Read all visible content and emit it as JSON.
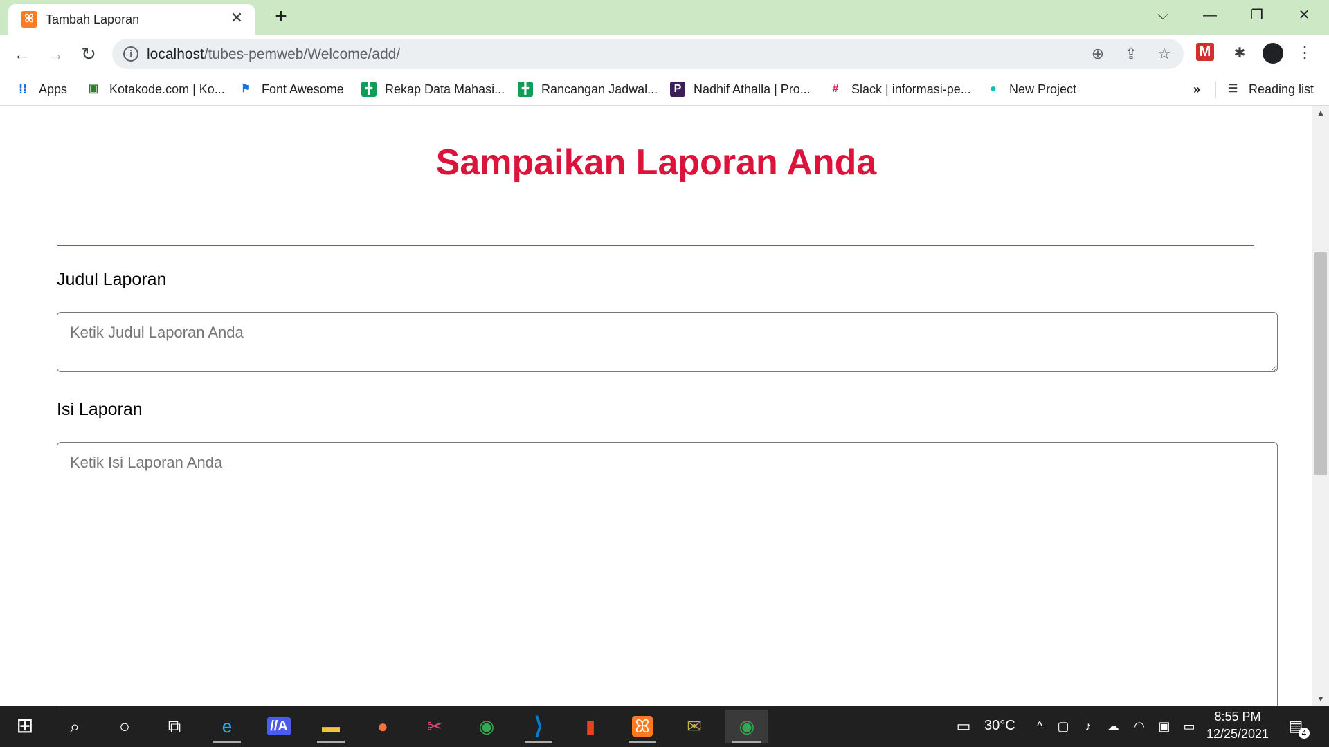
{
  "browser": {
    "tab": {
      "title": "Tambah Laporan",
      "favicon_glyph": "ꕤ",
      "favicon_color": "#fb7a24",
      "close_glyph": "✕"
    },
    "new_tab_glyph": "+",
    "window_controls": {
      "dropdown": "⌵",
      "minimize": "—",
      "restore": "❐",
      "close": "✕"
    },
    "nav": {
      "back": "←",
      "forward": "→",
      "reload": "↻"
    },
    "url": {
      "host": "localhost",
      "path": "/tubes-pemweb/Welcome/add/"
    },
    "omnibox_icons": {
      "info": "i",
      "zoom": "⊕",
      "share": "⇪",
      "star": "☆"
    },
    "extensions": {
      "ext1": "M",
      "puzzle": "✱",
      "menu": "⋮"
    },
    "bookmarks": [
      {
        "label": "Apps",
        "icon": "apps-grid",
        "glyph": "⁞⁞",
        "color": "#1a73e8"
      },
      {
        "label": "Kotakode.com | Ko...",
        "icon": "box",
        "glyph": "▣",
        "color": "#2e7d32"
      },
      {
        "label": "Font Awesome",
        "icon": "flag",
        "glyph": "⚑",
        "color": "#1c6fdb"
      },
      {
        "label": "Rekap Data Mahasi...",
        "icon": "sheets",
        "glyph": "╋",
        "color": "#0f9d58"
      },
      {
        "label": "Rancangan Jadwal...",
        "icon": "sheets",
        "glyph": "╋",
        "color": "#0f9d58"
      },
      {
        "label": "Nadhif Athalla | Pro...",
        "icon": "profile-p",
        "glyph": "P",
        "color": "#3b1f5b"
      },
      {
        "label": "Slack | informasi-pe...",
        "icon": "slack",
        "glyph": "#",
        "color": "#e01e5a"
      },
      {
        "label": "New Project",
        "icon": "project",
        "glyph": "●",
        "color": "#00c4b4"
      }
    ],
    "bookmarks_overflow": "»",
    "reading_list": {
      "label": "Reading list",
      "glyph": "☰"
    }
  },
  "page": {
    "title": "Sampaikan Laporan Anda",
    "title_color": "#dc143c",
    "fields": {
      "judul": {
        "label": "Judul Laporan",
        "placeholder": "Ketik Judul Laporan Anda",
        "value": ""
      },
      "isi": {
        "label": "Isi Laporan",
        "placeholder": "Ketik Isi Laporan Anda",
        "value": ""
      }
    }
  },
  "scrollbar": {
    "up": "▲",
    "down": "▼"
  },
  "taskbar": {
    "start_glyph": "⊞",
    "search_glyph": "⌕",
    "cortana_glyph": "○",
    "taskview_glyph": "⧉",
    "apps": [
      {
        "name": "edge",
        "glyph": "e",
        "color": "#2fa3e8"
      },
      {
        "name": "app-ai",
        "glyph": "//A",
        "color": "#4b5cf0"
      },
      {
        "name": "file-explorer",
        "glyph": "▬",
        "color": "#f3c33b"
      },
      {
        "name": "firefox",
        "glyph": "●",
        "color": "#ff7139"
      },
      {
        "name": "snip",
        "glyph": "✂",
        "color": "#e0467c"
      },
      {
        "name": "chrome",
        "glyph": "◉",
        "color": "#34a853"
      },
      {
        "name": "vscode",
        "glyph": "⟩",
        "color": "#007acc"
      },
      {
        "name": "office",
        "glyph": "▮",
        "color": "#e8431f"
      },
      {
        "name": "xampp",
        "glyph": "ꕤ",
        "color": "#fb7a24"
      },
      {
        "name": "app-misc",
        "glyph": "✉",
        "color": "#c8b04a"
      },
      {
        "name": "chrome-profile",
        "glyph": "◉",
        "color": "#34a853"
      }
    ],
    "weather": {
      "temp": "30°C",
      "glyph": "▭"
    },
    "tray_glyphs": {
      "chevron": "^",
      "meet": "▢",
      "volume": "♪",
      "onedrive": "☁",
      "wifi": "◠",
      "display": "▣",
      "battery": "▭"
    },
    "clock": {
      "time": "8:55 PM",
      "date": "12/25/2021"
    },
    "notifications": {
      "glyph": "▤",
      "count": "4"
    }
  }
}
